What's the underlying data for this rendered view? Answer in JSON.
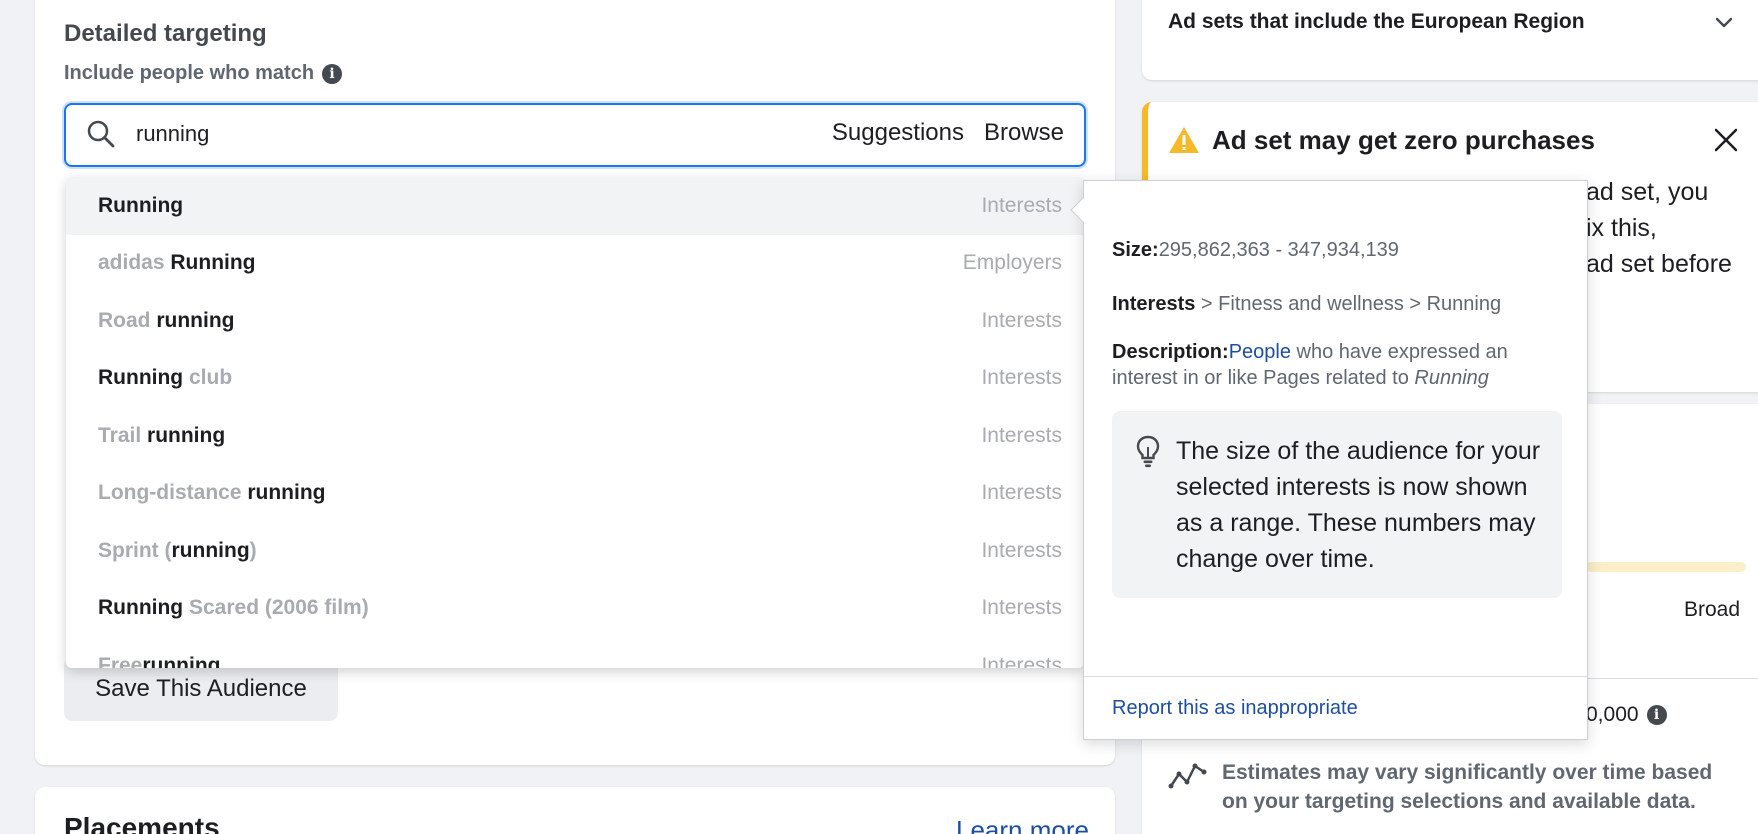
{
  "targeting": {
    "title": "Detailed targeting",
    "subtitle": "Include people who match",
    "info_glyph": "i",
    "search": {
      "value": "running",
      "suggestions_label": "Suggestions",
      "browse_label": "Browse"
    },
    "results": [
      {
        "pre": "",
        "match": "Running",
        "post": "",
        "category": "Interests"
      },
      {
        "pre": "adidas ",
        "match": "Running",
        "post": "",
        "category": "Employers"
      },
      {
        "pre": "Road ",
        "match": "running",
        "post": "",
        "category": "Interests"
      },
      {
        "pre": "",
        "match": "Running",
        "post": " club",
        "category": "Interests"
      },
      {
        "pre": "Trail ",
        "match": "running",
        "post": "",
        "category": "Interests"
      },
      {
        "pre": "Long-distance ",
        "match": "running",
        "post": "",
        "category": "Interests"
      },
      {
        "pre": "Sprint (",
        "match": "running",
        "post": ")",
        "category": "Interests"
      },
      {
        "pre": "",
        "match": "Running",
        "post": " Scared (2006 film)",
        "category": "Interests"
      },
      {
        "pre": "Free",
        "match": "running",
        "post": "",
        "category": "Interests"
      }
    ],
    "save_audience_label": "Save This Audience"
  },
  "placements": {
    "title": "Placements",
    "learn_more": "Learn more"
  },
  "eu_region": {
    "label": "Ad sets that include the European Region"
  },
  "warning": {
    "title": "Ad set may get zero purchases",
    "body_lines": [
      "ad set, you",
      "ix this,",
      "ad set before"
    ],
    "accent_color": "#f7b928"
  },
  "audience": {
    "broad_label": "Broad",
    "size_partial": "0,000",
    "info_glyph": "i",
    "estimate_note": "Estimates may vary significantly over time based on your targeting selections and available data."
  },
  "popover": {
    "size_label": "Size:",
    "size_value": "295,862,363 - 347,934,139",
    "path_root": "Interests",
    "path_rest": " > Fitness and wellness > Running",
    "description_label": "Description:",
    "description_link": "People",
    "description_text": " who have expressed an interest in or like Pages related to ",
    "description_topic": "Running",
    "tip": "The size of the audience for your selected interests is now shown as a range. These numbers may change over time.",
    "report_link": "Report this as inappropriate"
  }
}
